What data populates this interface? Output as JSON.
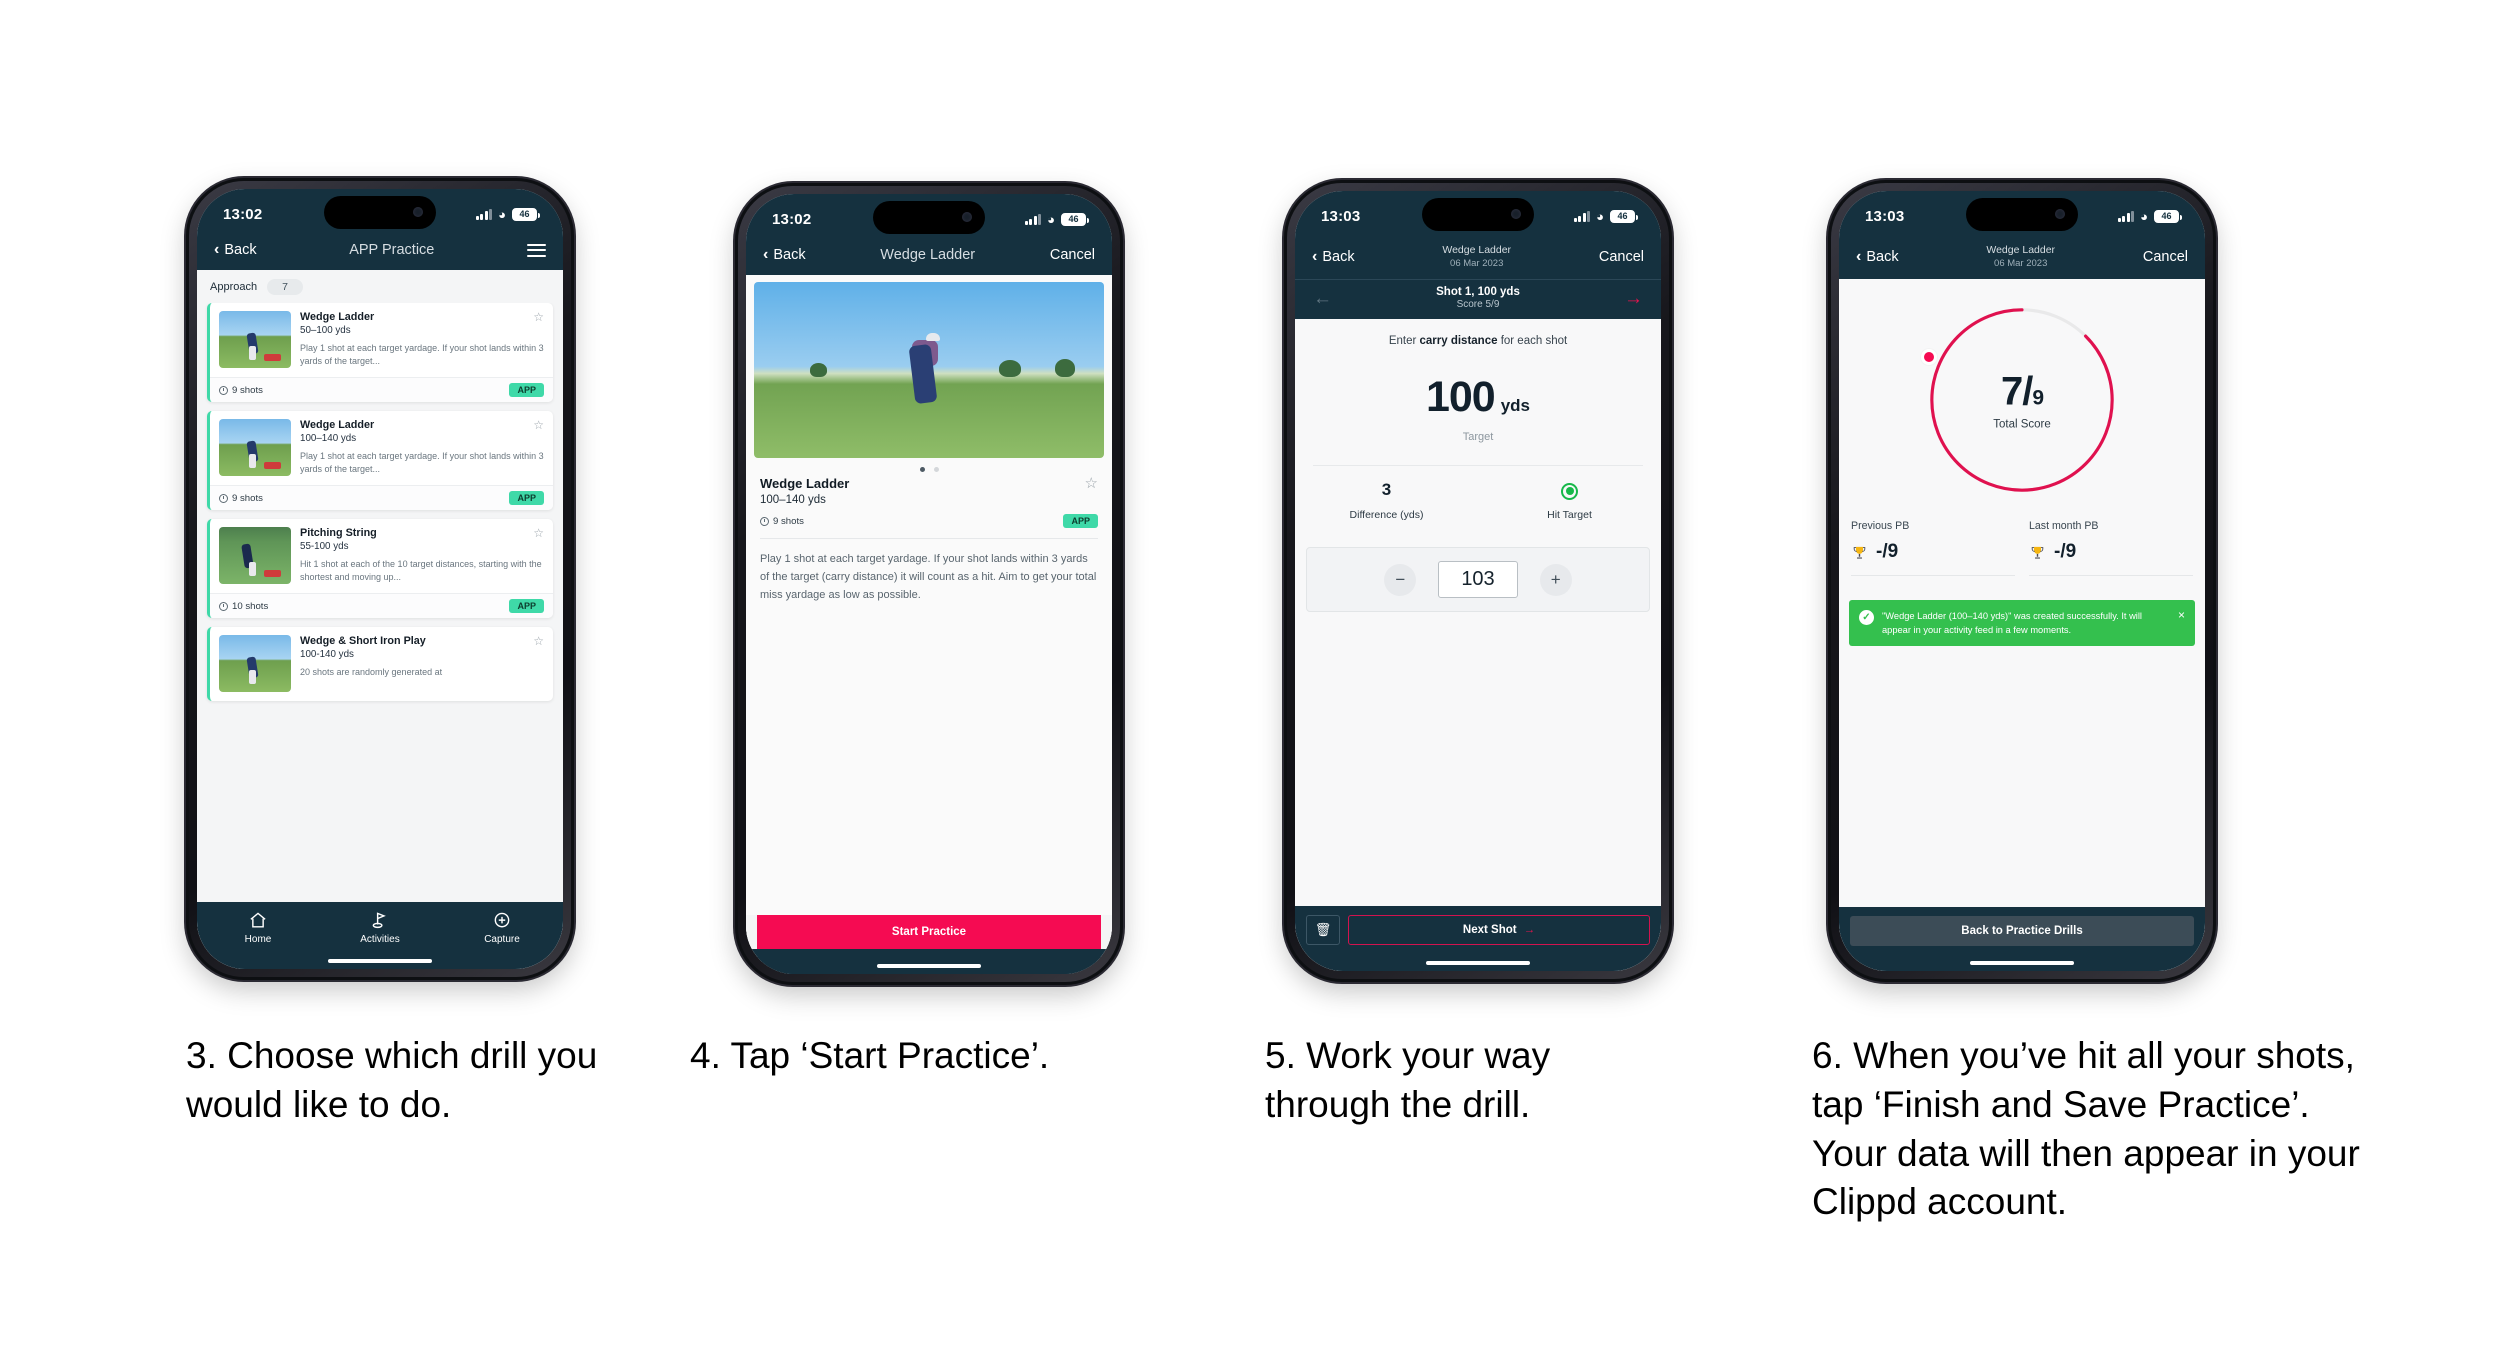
{
  "phones": [
    {
      "status": {
        "time": "13:02",
        "battery": "46"
      },
      "nav": {
        "back": "Back",
        "title": "APP Practice",
        "menu": "menu-icon"
      },
      "filter": {
        "label": "Approach",
        "count": "7"
      },
      "cards": [
        {
          "title": "Wedge Ladder",
          "yards": "50–100 yds",
          "desc": "Play 1 shot at each target yardage. If your shot lands within 3 yards of the target...",
          "shots": "9 shots",
          "badge": "APP"
        },
        {
          "title": "Wedge Ladder",
          "yards": "100–140 yds",
          "desc": "Play 1 shot at each target yardage. If your shot lands within 3 yards of the target...",
          "shots": "9 shots",
          "badge": "APP"
        },
        {
          "title": "Pitching String",
          "yards": "55-100 yds",
          "desc": "Hit 1 shot at each of the 10 target distances, starting with the shortest and moving up...",
          "shots": "10 shots",
          "badge": "APP"
        },
        {
          "title": "Wedge & Short Iron Play",
          "yards": "100-140 yds",
          "desc": "20 shots are randomly generated at",
          "shots": "",
          "badge": ""
        }
      ],
      "tabs": [
        {
          "label": "Home",
          "icon": "home-icon"
        },
        {
          "label": "Activities",
          "icon": "golf-flag-icon"
        },
        {
          "label": "Capture",
          "icon": "plus-circle-icon"
        }
      ]
    },
    {
      "status": {
        "time": "13:02",
        "battery": "46"
      },
      "nav": {
        "back": "Back",
        "title": "Wedge Ladder",
        "cancel": "Cancel"
      },
      "detail": {
        "title": "Wedge Ladder",
        "yards": "100–140 yds",
        "shots": "9 shots",
        "badge": "APP",
        "description": "Play 1 shot at each target yardage. If your shot lands within 3 yards of the target (carry distance) it will count as a hit. Aim to get your total miss yardage as low as possible."
      },
      "cta": "Start Practice"
    },
    {
      "status": {
        "time": "13:03",
        "battery": "46"
      },
      "nav": {
        "back": "Back",
        "title": "Wedge Ladder",
        "subtitle": "06 Mar 2023",
        "cancel": "Cancel"
      },
      "subhead": {
        "title": "Shot 1, 100 yds",
        "score": "Score 5/9"
      },
      "prompt_pre": "Enter ",
      "prompt_bold": "carry distance",
      "prompt_post": " for each shot",
      "target": {
        "value": "100",
        "unit": "yds",
        "caption": "Target"
      },
      "stats": [
        {
          "value": "3",
          "label": "Difference (yds)"
        },
        {
          "value": "hit-target-icon",
          "label": "Hit Target"
        }
      ],
      "stepper": {
        "minus": "−",
        "value": "103",
        "plus": "+"
      },
      "footer": {
        "delete": "trash-icon",
        "next": "Next Shot"
      }
    },
    {
      "status": {
        "time": "13:03",
        "battery": "46"
      },
      "nav": {
        "back": "Back",
        "title": "Wedge Ladder",
        "subtitle": "06 Mar 2023",
        "cancel": "Cancel"
      },
      "gauge": {
        "score": "7",
        "divider": "/",
        "total": "9",
        "label": "Total Score"
      },
      "pbs": [
        {
          "label": "Previous PB",
          "icon": "trophy-icon",
          "value": "-/9"
        },
        {
          "label": "Last month PB",
          "icon": "trophy-icon",
          "value": "-/9"
        }
      ],
      "toast": {
        "icon": "check-circle-icon",
        "message": "\"Wedge Ladder (100–140 yds)\" was created successfully. It will appear in your activity feed in a few moments.",
        "close": "×"
      },
      "footer": {
        "button": "Back to Practice Drills"
      }
    }
  ],
  "captions": [
    "3. Choose which drill you would like to do.",
    "4. Tap ‘Start Practice’.",
    "5. Work your way through the drill.",
    "6. When you’ve hit all your shots, tap ‘Finish and Save Practice’. Your data will then appear in your Clippd account."
  ],
  "colors": {
    "nav_dark": "#15313f",
    "accent_pink": "#f50b52",
    "accent_teal": "#3fd9a8",
    "toast_green": "#34c04e"
  }
}
